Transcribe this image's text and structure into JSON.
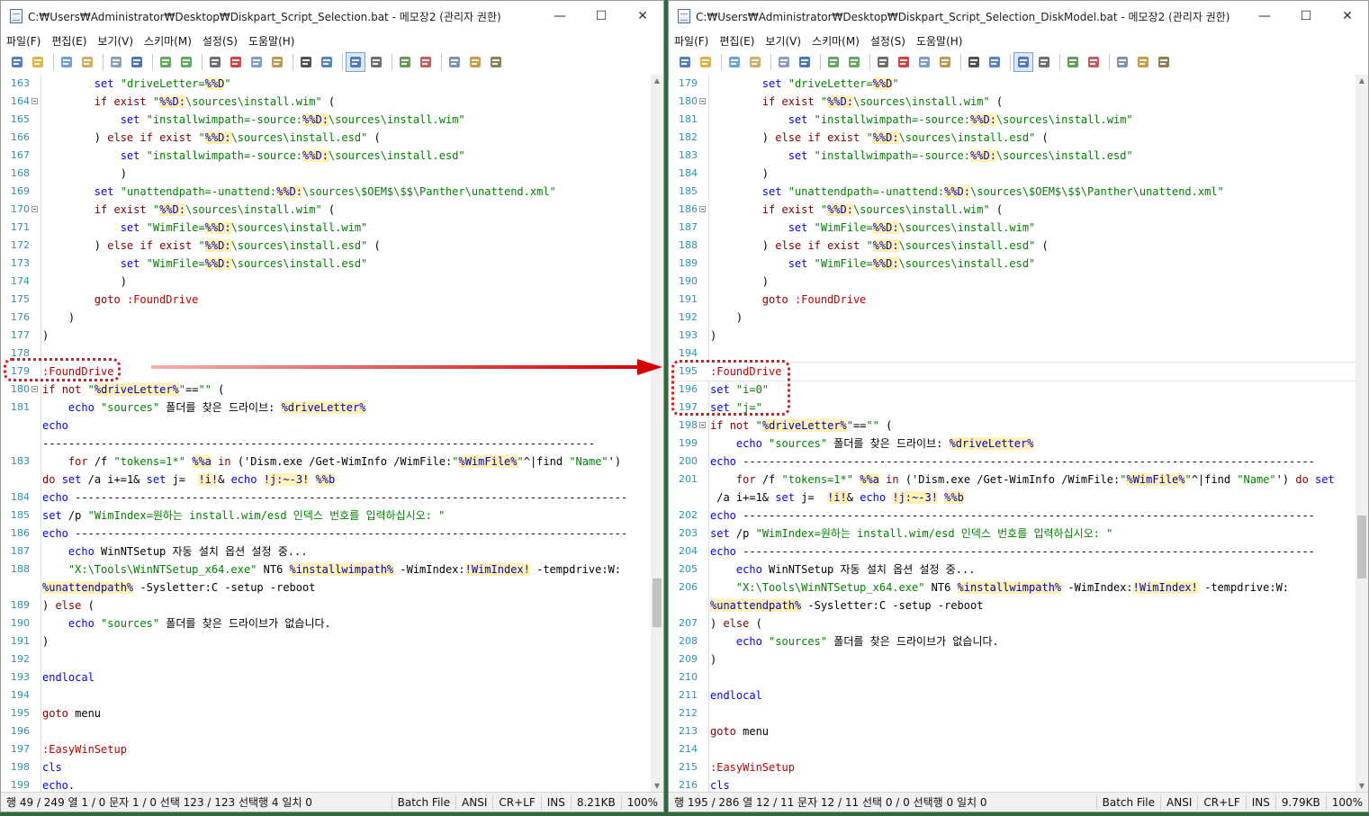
{
  "left": {
    "title": "C:₩Users₩Administrator₩Desktop₩Diskpart_Script_Selection.bat - 메모장2 (관리자 권한)",
    "menu": [
      "파일(F)",
      "편집(E)",
      "보기(V)",
      "스키마(M)",
      "설정(S)",
      "도움말(H)"
    ],
    "lines": [
      {
        "n": "163",
        "text": "        set \"driveLetter=%%D\""
      },
      {
        "n": "164",
        "text": "        if exist \"%%D:\\sources\\install.wim\" (",
        "fold": true
      },
      {
        "n": "165",
        "text": "            set \"installwimpath=-source:%%D:\\sources\\install.wim\""
      },
      {
        "n": "166",
        "text": "        ) else if exist \"%%D:\\sources\\install.esd\" ("
      },
      {
        "n": "167",
        "text": "            set \"installwimpath=-source:%%D:\\sources\\install.esd\""
      },
      {
        "n": "168",
        "text": "            )"
      },
      {
        "n": "169",
        "text": "        set \"unattendpath=-unattend:%%D:\\sources\\$OEM$\\$$\\Panther\\unattend.xml\""
      },
      {
        "n": "170",
        "text": "        if exist \"%%D:\\sources\\install.wim\" (",
        "fold": true
      },
      {
        "n": "171",
        "text": "            set \"WimFile=%%D:\\sources\\install.wim\""
      },
      {
        "n": "172",
        "text": "        ) else if exist \"%%D:\\sources\\install.esd\" ("
      },
      {
        "n": "173",
        "text": "            set \"WimFile=%%D:\\sources\\install.esd\""
      },
      {
        "n": "174",
        "text": "            )"
      },
      {
        "n": "175",
        "text": "        goto :FoundDrive"
      },
      {
        "n": "176",
        "text": "    )"
      },
      {
        "n": "177",
        "text": ")"
      },
      {
        "n": "178",
        "text": ""
      },
      {
        "n": "179",
        "text": ":FoundDrive"
      },
      {
        "n": "180",
        "text": "if not \"%driveLetter%\"==\"\" (",
        "fold": true
      },
      {
        "n": "181",
        "text": "    echo \"sources\" 폴더를 찾은 드라이브: %driveLetter%"
      },
      {
        "n": "",
        "text": "echo"
      },
      {
        "n": "",
        "text": "-------------------------------------------------------------------------------------"
      },
      {
        "n": "183",
        "text": "    for /f \"tokens=1*\" %%a in ('Dism.exe /Get-WimInfo /WimFile:\"%WimFile%\"^|find \"Name\"')"
      },
      {
        "n": "",
        "text": "do set /a i+=1& set j=  !i!& echo !j:~-3! %%b"
      },
      {
        "n": "184",
        "text": "echo -------------------------------------------------------------------------------------"
      },
      {
        "n": "185",
        "text": "set /p \"WimIndex=원하는 install.wim/esd 인덱스 번호를 입력하십시오: \""
      },
      {
        "n": "186",
        "text": "echo -------------------------------------------------------------------------------------"
      },
      {
        "n": "187",
        "text": "    echo WinNTSetup 자동 설치 옵션 설정 중..."
      },
      {
        "n": "188",
        "text": "    \"X:\\Tools\\WinNTSetup_x64.exe\" NT6 %installwimpath% -WimIndex:!WimIndex! -tempdrive:W:"
      },
      {
        "n": "",
        "text": "%unattendpath% -Sysletter:C -setup -reboot"
      },
      {
        "n": "189",
        "text": ") else ("
      },
      {
        "n": "190",
        "text": "    echo \"sources\" 폴더를 찾은 드라이브가 없습니다."
      },
      {
        "n": "191",
        "text": ")"
      },
      {
        "n": "192",
        "text": ""
      },
      {
        "n": "193",
        "text": "endlocal"
      },
      {
        "n": "194",
        "text": ""
      },
      {
        "n": "195",
        "text": "goto menu"
      },
      {
        "n": "196",
        "text": ""
      },
      {
        "n": "197",
        "text": ":EasyWinSetup"
      },
      {
        "n": "198",
        "text": "cls"
      },
      {
        "n": "199",
        "text": "echo."
      }
    ],
    "status": {
      "main": "행 49 / 249  열 1 / 0  문자 1 / 0  선택 123 / 123  선택행 4  일치 0",
      "cells": [
        "Batch File",
        "ANSI",
        "CR+LF",
        "INS",
        "8.21KB",
        "100%"
      ]
    }
  },
  "right": {
    "title": "C:₩Users₩Administrator₩Desktop₩Diskpart_Script_Selection_DiskModel.bat - 메모장2 (관리자 권한)",
    "menu": [
      "파일(F)",
      "편집(E)",
      "보기(V)",
      "스키마(M)",
      "설정(S)",
      "도움말(H)"
    ],
    "lines": [
      {
        "n": "179",
        "text": "        set \"driveLetter=%%D\""
      },
      {
        "n": "180",
        "text": "        if exist \"%%D:\\sources\\install.wim\" (",
        "fold": true
      },
      {
        "n": "181",
        "text": "            set \"installwimpath=-source:%%D:\\sources\\install.wim\""
      },
      {
        "n": "182",
        "text": "        ) else if exist \"%%D:\\sources\\install.esd\" ("
      },
      {
        "n": "183",
        "text": "            set \"installwimpath=-source:%%D:\\sources\\install.esd\""
      },
      {
        "n": "184",
        "text": "        )"
      },
      {
        "n": "185",
        "text": "        set \"unattendpath=-unattend:%%D:\\sources\\$OEM$\\$$\\Panther\\unattend.xml\""
      },
      {
        "n": "186",
        "text": "        if exist \"%%D:\\sources\\install.wim\" (",
        "fold": true
      },
      {
        "n": "187",
        "text": "            set \"WimFile=%%D:\\sources\\install.wim\""
      },
      {
        "n": "188",
        "text": "        ) else if exist \"%%D:\\sources\\install.esd\" ("
      },
      {
        "n": "189",
        "text": "            set \"WimFile=%%D:\\sources\\install.esd\""
      },
      {
        "n": "190",
        "text": "        )"
      },
      {
        "n": "191",
        "text": "        goto :FoundDrive"
      },
      {
        "n": "192",
        "text": "    )"
      },
      {
        "n": "193",
        "text": ")"
      },
      {
        "n": "194",
        "text": ""
      },
      {
        "n": "195",
        "text": ":FoundDrive",
        "current": true
      },
      {
        "n": "196",
        "text": "set \"i=0\""
      },
      {
        "n": "197",
        "text": "set \"j=\""
      },
      {
        "n": "198",
        "text": "if not \"%driveLetter%\"==\"\" (",
        "fold": true
      },
      {
        "n": "199",
        "text": "    echo \"sources\" 폴더를 찾은 드라이브: %driveLetter%"
      },
      {
        "n": "200",
        "text": "echo ----------------------------------------------------------------------------------------"
      },
      {
        "n": "201",
        "text": "    for /f \"tokens=1*\" %%a in ('Dism.exe /Get-WimInfo /WimFile:\"%WimFile%\"^|find \"Name\"') do set"
      },
      {
        "n": "",
        "text": " /a i+=1& set j=  !i!& echo !j:~-3! %%b"
      },
      {
        "n": "202",
        "text": "echo ----------------------------------------------------------------------------------------"
      },
      {
        "n": "203",
        "text": "set /p \"WimIndex=원하는 install.wim/esd 인덱스 번호를 입력하십시오: \""
      },
      {
        "n": "204",
        "text": "echo ----------------------------------------------------------------------------------------"
      },
      {
        "n": "205",
        "text": "    echo WinNTSetup 자동 설치 옵션 설정 중..."
      },
      {
        "n": "206",
        "text": "    \"X:\\Tools\\WinNTSetup_x64.exe\" NT6 %installwimpath% -WimIndex:!WimIndex! -tempdrive:W:"
      },
      {
        "n": "",
        "text": "%unattendpath% -Sysletter:C -setup -reboot"
      },
      {
        "n": "207",
        "text": ") else ("
      },
      {
        "n": "208",
        "text": "    echo \"sources\" 폴더를 찾은 드라이브가 없습니다."
      },
      {
        "n": "209",
        "text": ")"
      },
      {
        "n": "210",
        "text": ""
      },
      {
        "n": "211",
        "text": "endlocal"
      },
      {
        "n": "212",
        "text": ""
      },
      {
        "n": "213",
        "text": "goto menu"
      },
      {
        "n": "214",
        "text": ""
      },
      {
        "n": "215",
        "text": ":EasyWinSetup"
      },
      {
        "n": "216",
        "text": "cls"
      }
    ],
    "status": {
      "main": "행 195 / 286  열 12 / 11  문자 12 / 11  선택 0 / 0  선택행 0  일치 0",
      "cells": [
        "Batch File",
        "ANSI",
        "CR+LF",
        "INS",
        "9.79KB",
        "100%"
      ]
    }
  },
  "toolbar_icons": [
    "new-file-icon",
    "open-file-icon",
    "sep",
    "new-doc-icon",
    "open-folder-icon",
    "sep",
    "save-icon",
    "save-as-icon",
    "sep",
    "undo-icon",
    "redo-icon",
    "sep",
    "cut-icon",
    "delete-icon",
    "copy-icon",
    "paste-icon",
    "sep",
    "find-icon",
    "replace-icon",
    "sep",
    "word-wrap-icon",
    "view-options-icon",
    "sep",
    "zoom-in-icon",
    "zoom-out-icon",
    "sep",
    "schema-icon",
    "customize-icon",
    "settings-icon"
  ],
  "colors": {
    "keyword": "#0000ff",
    "command": "#800000",
    "string": "#008000",
    "variable_bg": "#fff2b3",
    "label": "#c00000",
    "line_number": "#2b91af",
    "annotation": "#e01818"
  }
}
